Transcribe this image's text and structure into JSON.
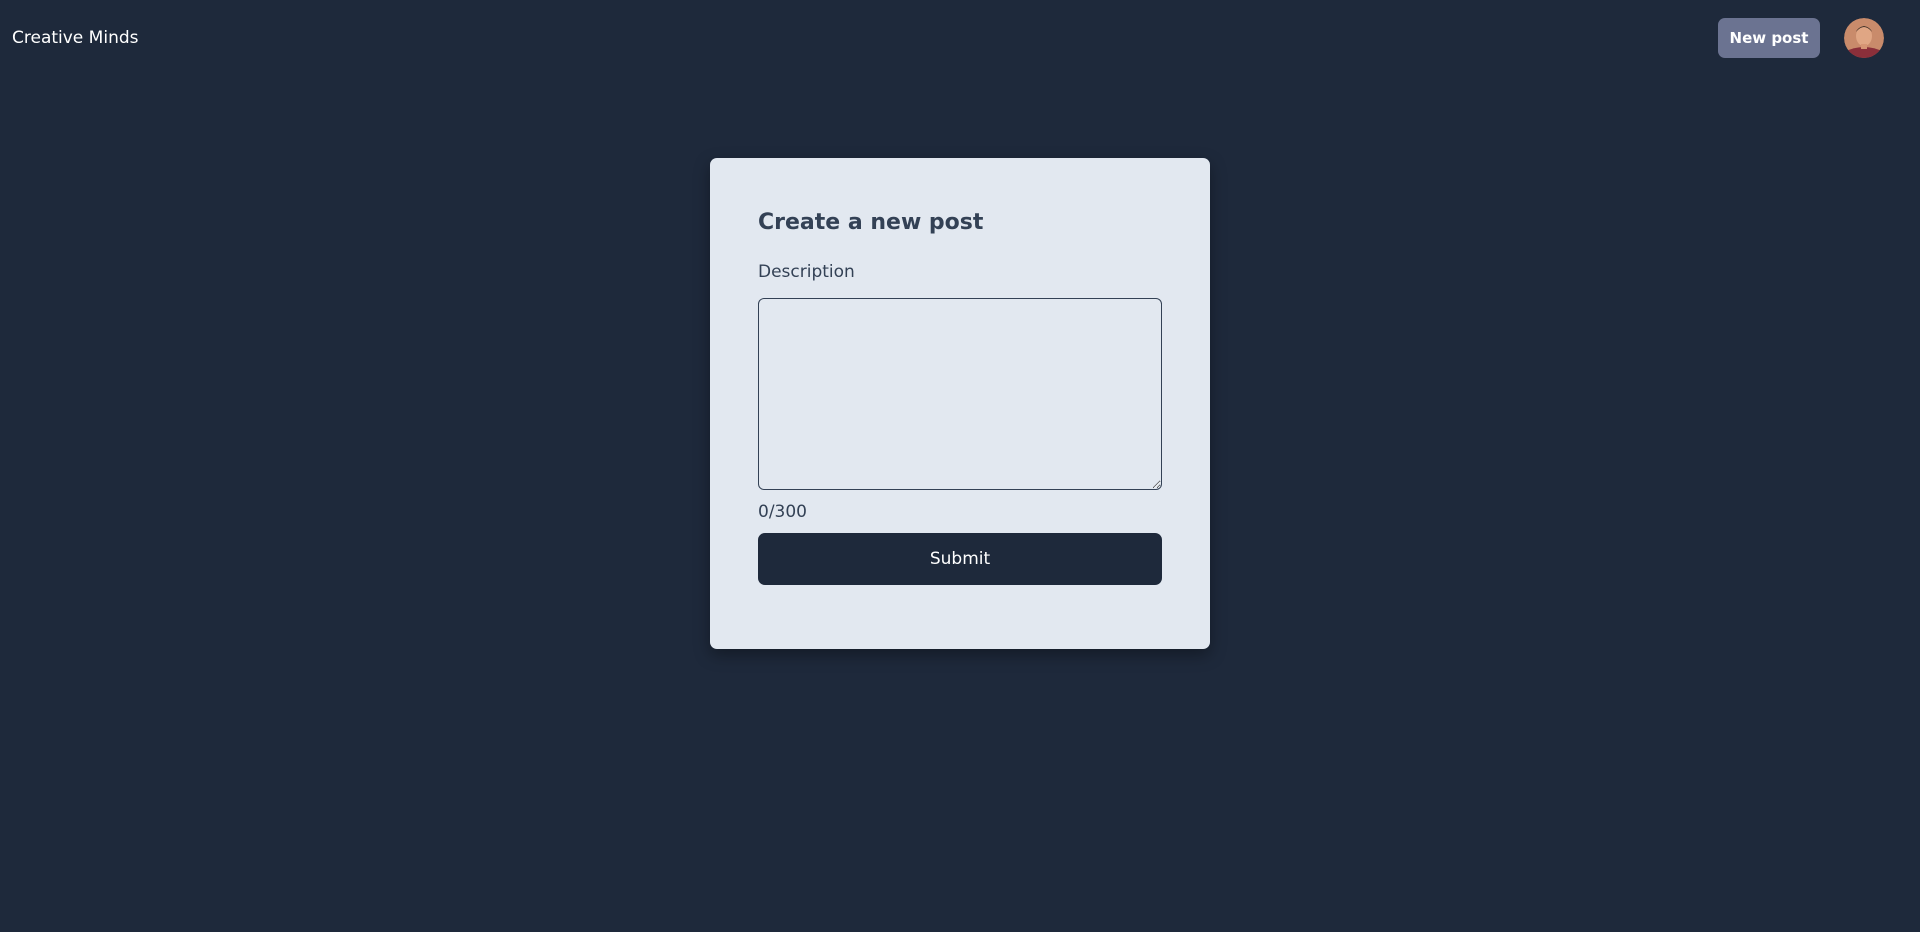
{
  "header": {
    "brand": "Creative Minds",
    "new_post_label": "New post",
    "avatar_icon": "user-avatar"
  },
  "form": {
    "title": "Create a new post",
    "description_label": "Description",
    "description_value": "",
    "description_placeholder": "",
    "char_counter": "0/300",
    "submit_label": "Submit"
  },
  "colors": {
    "background": "#1e293b",
    "card": "#e2e8f0",
    "new_post_button": "#6b7391",
    "submit_button": "#1e293b",
    "text_dark": "#334155"
  }
}
